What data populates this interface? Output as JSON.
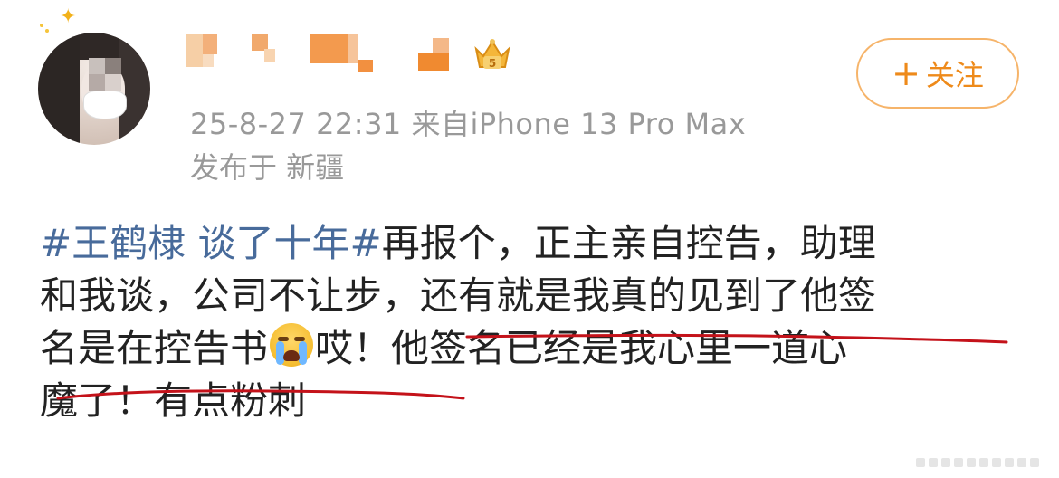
{
  "post_header": {
    "timestamp": "25-8-27 22:31",
    "source": "来自iPhone 13 Pro Max",
    "location": "发布于 新疆"
  },
  "follow_button": {
    "plus": "+",
    "label": "关注"
  },
  "post_body": {
    "topic": "#王鹤棣 谈了十年#",
    "line1_rest": "再报个，正主亲自控告，助理",
    "line2": "和我谈，公司不让步，还有就是我真的见到了他签",
    "line3_before_emoji": "名是在控告书",
    "line3_after_emoji": "哎！他签名已经是我心里一道心",
    "line4": "魔了！有点粉刺"
  },
  "colors": {
    "topic": "#486b9b",
    "follow_border": "#f6b46a",
    "follow_text": "#ee8a1a",
    "underline": "#c4121a",
    "meta_text": "#999999"
  },
  "icons": {
    "avatar": "avatar",
    "badge": "crown-badge-icon",
    "emoji": "crying-emoji-icon"
  }
}
